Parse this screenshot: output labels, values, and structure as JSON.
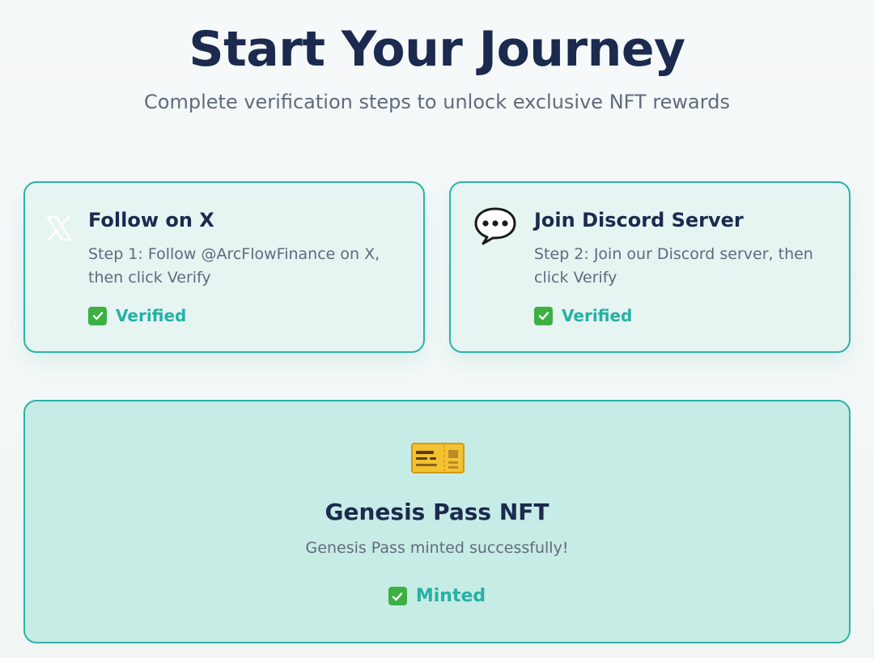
{
  "header": {
    "title": "Start Your Journey",
    "subtitle": "Complete verification steps to unlock exclusive NFT rewards"
  },
  "steps": [
    {
      "icon": "x-logo-icon",
      "title": "Follow on X",
      "description": "Step 1: Follow @ArcFlowFinance on X, then click Verify",
      "status": "Verified"
    },
    {
      "icon": "speech-bubble-icon",
      "title": "Join Discord Server",
      "description": "Step 2: Join our Discord server, then click Verify",
      "status": "Verified"
    }
  ],
  "reward": {
    "icon": "ticket-icon",
    "title": "Genesis Pass NFT",
    "description": "Genesis Pass minted successfully!",
    "status": "Minted"
  },
  "colors": {
    "accent": "#2bb3a6",
    "status_text": "#24b1a5",
    "check_green": "#3cb043",
    "heading": "#1b2a4e",
    "body_text": "#5f6b7c"
  }
}
